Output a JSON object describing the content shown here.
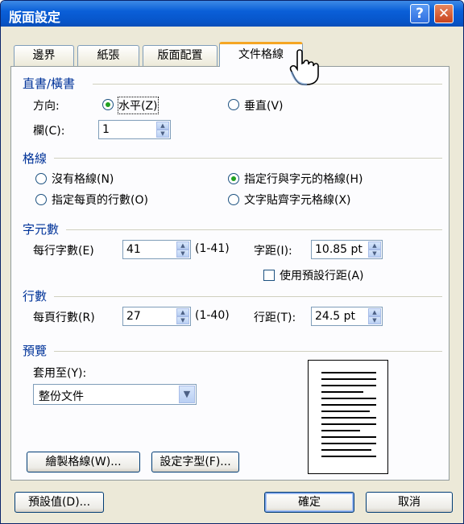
{
  "window": {
    "title": "版面設定"
  },
  "title_buttons": {
    "help": "?",
    "close": "✕"
  },
  "tabs": [
    {
      "label": "邊界",
      "active": false
    },
    {
      "label": "紙張",
      "active": false
    },
    {
      "label": "版面配置",
      "active": false
    },
    {
      "label": "文件格線",
      "active": true
    }
  ],
  "direction_section": {
    "title": "直書/橫書",
    "orientation_label": "方向:",
    "horizontal": "水平(Z)",
    "vertical": "垂直(V)",
    "columns_label": "欄(C):",
    "columns_value": "1"
  },
  "grid_section": {
    "title": "格線",
    "options": [
      "沒有格線(N)",
      "指定行與字元的格線(H)",
      "指定每頁的行數(O)",
      "文字貼齊字元格線(X)"
    ],
    "selected": "指定行與字元的格線(H)"
  },
  "chars_section": {
    "title": "字元數",
    "per_line_label": "每行字數(E)",
    "per_line_value": "41",
    "per_line_range": "(1-41)",
    "pitch_label": "字距(I):",
    "pitch_value": "10.85 pt",
    "default_pitch_label": "使用預設行距(A)"
  },
  "lines_section": {
    "title": "行數",
    "per_page_label": "每頁行數(R)",
    "per_page_value": "27",
    "per_page_range": "(1-40)",
    "pitch_label": "行距(T):",
    "pitch_value": "24.5 pt"
  },
  "preview_section": {
    "title": "預覽",
    "apply_to_label": "套用至(Y):",
    "apply_to_value": "整份文件"
  },
  "buttons": {
    "draw_grid": "繪製格線(W)...",
    "set_font": "設定字型(F)...",
    "default": "預設值(D)...",
    "ok": "確定",
    "cancel": "取消"
  },
  "colors": {
    "title_bar": "#0a5fd8",
    "section_text": "#003399",
    "active_tab_accent": "#f5a623"
  }
}
